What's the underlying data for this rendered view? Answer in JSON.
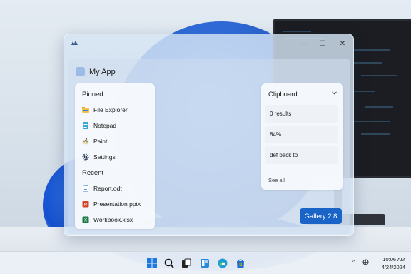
{
  "window": {
    "title": "My App",
    "controls": {
      "minimize": "—",
      "maximize": "☐",
      "close": "✕"
    }
  },
  "pinned": {
    "title": "Pinned",
    "items": [
      {
        "label": "File Explorer",
        "icon": "folder-icon"
      },
      {
        "label": "Notepad",
        "icon": "notepad-icon"
      },
      {
        "label": "Paint",
        "icon": "paint-icon"
      },
      {
        "label": "Settings",
        "icon": "gear-icon"
      }
    ]
  },
  "recent": {
    "title": "Recent",
    "items": [
      {
        "label": "Report.odt",
        "icon": "document-icon"
      },
      {
        "label": "Presentation pptx",
        "icon": "powerpoint-icon"
      },
      {
        "label": "Workbook.xlsx",
        "icon": "excel-icon"
      }
    ]
  },
  "clipboard": {
    "title": "Clipboard",
    "items": [
      "0 results",
      "84%",
      "def back to"
    ],
    "see_all": "See all"
  },
  "gallery_button": "Gallery 2.8",
  "taskbar": {
    "clock_time": "10:06 AM",
    "clock_date": "4/24/2024",
    "tray_chevron": "^"
  },
  "colors": {
    "accent": "#1a63c7",
    "window_bg": "#d6e4f3",
    "wallpaper_bloom": "#1d5fd8"
  }
}
